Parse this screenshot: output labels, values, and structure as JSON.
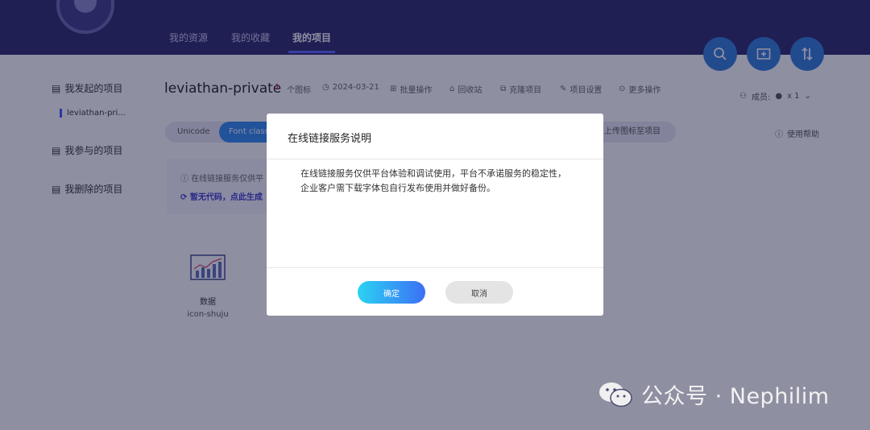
{
  "nav": {
    "tabs": [
      {
        "label": "我的资源",
        "active": false
      },
      {
        "label": "我的收藏",
        "active": false
      },
      {
        "label": "我的项目",
        "active": true
      }
    ],
    "buttons": [
      "search-icon",
      "add-folder-icon",
      "sort-icon"
    ]
  },
  "sidebar": {
    "items": [
      {
        "label": "我发起的项目",
        "icon": "folder-icon"
      },
      {
        "label": "我参与的项目",
        "icon": "folder-icon"
      },
      {
        "label": "我删除的项目",
        "icon": "trash-folder-icon"
      }
    ],
    "sub_item": "leviathan-pri..."
  },
  "project": {
    "title": "leviathan-private",
    "icon_count": "1",
    "icon_count_suffix": "个图标",
    "date": "2024-03-21",
    "actions": [
      "批量操作",
      "回收站",
      "克隆项目",
      "项目设置",
      "更多操作"
    ],
    "members_label": "成员:",
    "members_count": "x 1"
  },
  "tabs": {
    "unicode": "Unicode",
    "font_class": "Font class",
    "upload": "上传图标至项目"
  },
  "help_label": "使用帮助",
  "notice": {
    "text": "在线链接服务仅供平",
    "link": "暂无代码，点此生成"
  },
  "icon_card": {
    "name": "数据",
    "code": "icon-shuju"
  },
  "modal": {
    "title": "在线链接服务说明",
    "body": "在线链接服务仅供平台体验和调试使用，平台不承诺服务的稳定性，企业客户需下载字体包自行发布使用并做好备份。",
    "ok_label": "确定",
    "cancel_label": "取消"
  },
  "watermark": "公众号 · Nephilim",
  "colors": {
    "nav_bg": "#2a2a6a",
    "accent": "#2d8af0",
    "ok_gradient_start": "#2ad3f2",
    "ok_gradient_end": "#3d6ff5"
  }
}
